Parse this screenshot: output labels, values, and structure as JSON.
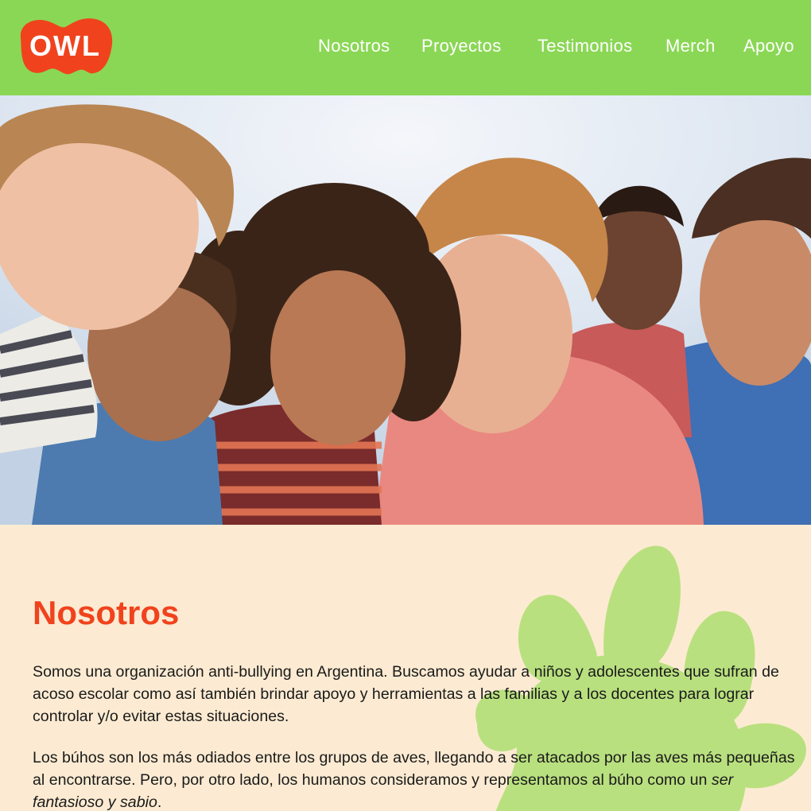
{
  "brand": {
    "logo_text": "OWL",
    "colors": {
      "header_bg": "#8AD755",
      "logo_red": "#F0431D",
      "page_bg": "#FCEBD2",
      "title_red": "#F0431D",
      "handprint_green": "#B9E07F"
    }
  },
  "nav": {
    "items": [
      {
        "label": "Nosotros"
      },
      {
        "label": "Proyectos"
      },
      {
        "label": "Testimonios"
      },
      {
        "label": "Merch"
      },
      {
        "label": "Apoyo"
      }
    ]
  },
  "hero": {
    "image": "group-of-smiling-children-photo"
  },
  "about": {
    "title": "Nosotros",
    "paragraph1": "Somos una organización anti-bullying en Argentina. Buscamos ayudar a niños y adolescentes que sufran de acoso escolar como así también brindar apoyo y herramientas a las familias y a los docentes para lograr controlar y/o evitar estas situaciones.",
    "paragraph2_start": "Los búhos son los más odiados entre los grupos de aves, llegando a ser atacados por las aves más pequeñas al encontrarse. Pero, por otro lado, los humanos consideramos y representamos al búho como un ",
    "paragraph2_emphasis": "ser fantasioso y sabio",
    "paragraph2_end": "."
  }
}
